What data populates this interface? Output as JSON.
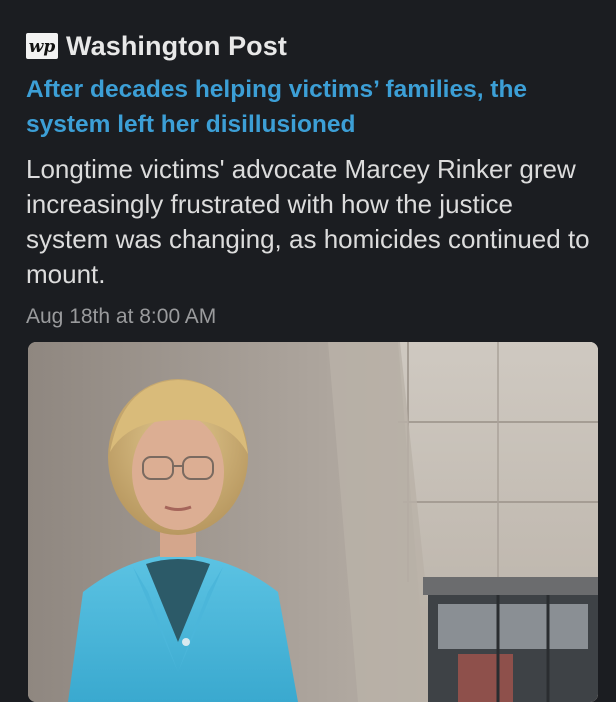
{
  "source": {
    "logo_icon": "washington-post-logo-icon",
    "name": "Washington Post"
  },
  "article": {
    "headline": "After decades helping victims’ families, the system left her disillusioned",
    "description": "Longtime victims' advocate Marcey Rinker grew increasingly frustrated with how the justice system was changing, as homicides continued to mount.",
    "timestamp": "Aug 18th at 8:00 AM"
  },
  "colors": {
    "background": "#1b1d21",
    "headline_link": "#3c9fd6",
    "body_text": "#dcdcdc",
    "timestamp": "#9a9b9d"
  }
}
